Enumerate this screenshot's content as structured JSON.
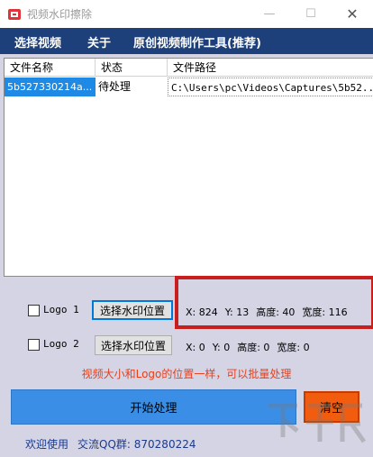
{
  "window": {
    "title": "视频水印擦除",
    "controls": {
      "minimize": "—",
      "maximize": "☐",
      "close": "✕"
    }
  },
  "menu": {
    "items": [
      "选择视频",
      "关于",
      "原创视频制作工具(推荐)"
    ]
  },
  "file_list": {
    "columns": [
      "文件名称",
      "状态",
      "文件路径"
    ],
    "rows": [
      {
        "name": "5b527330214a...",
        "status": "待处理",
        "path": "C:\\Users\\pc\\Videos\\Captures\\5b52..."
      }
    ]
  },
  "logo1": {
    "checkbox_label": "Logo 1",
    "button_label": "选择水印位置",
    "x": "X: 824",
    "y": "Y: 13",
    "height": "高度: 40",
    "width": "宽度: 116"
  },
  "logo2": {
    "checkbox_label": "Logo 2",
    "button_label": "选择水印位置",
    "x": "X: 0",
    "y": "Y: 0",
    "height": "高度: 0",
    "width": "宽度: 0"
  },
  "hint": "视频大小和Logo的位置一样，可以批量处理",
  "actions": {
    "start": "开始处理",
    "clear": "清空"
  },
  "footer": {
    "welcome": "欢迎使用",
    "qq_group": "交流QQ群: 870280224"
  },
  "colors": {
    "menu_bg": "#1d3f7a",
    "selection": "#1e8ae6",
    "start_btn": "#3a8ee6",
    "clear_btn": "#f25c0f",
    "hint": "#e8401c",
    "highlight": "#c81e1e"
  }
}
